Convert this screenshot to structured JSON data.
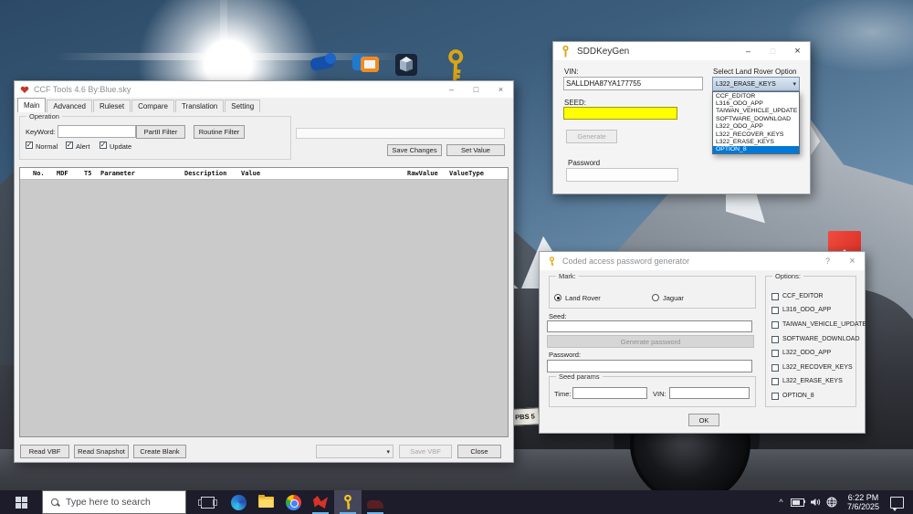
{
  "icons": {
    "minimize": "–",
    "maximize": "□",
    "close": "×",
    "help": "?",
    "dropdown_arrow": "▾",
    "check": "✓",
    "tray_chevron": "^"
  },
  "desktop": {
    "license_plate": "PBS 5",
    "taskbar": {
      "search_placeholder": "Type here to search",
      "clock_time": "6:22 PM",
      "clock_date": "7/6/2025"
    }
  },
  "ccf_tools": {
    "title": "CCF Tools 4.6  By:Blue.sky",
    "tabs": [
      "Main",
      "Advanced",
      "Ruleset",
      "Compare",
      "Translation",
      "Setting"
    ],
    "operation": {
      "label": "Operation",
      "keyword_label": "KeyWord:",
      "keyword_value": "",
      "partii_filter_button": "PartII Filter",
      "routine_filter_button": "Routine Filter",
      "filter_checkboxes": [
        "Normal",
        "Alert",
        "Update"
      ]
    },
    "save_changes_button": "Save Changes",
    "set_value_button": "Set Value",
    "table_headers": [
      "No.",
      "MDF",
      "T5",
      "Parameter",
      "Description",
      "Value",
      "RawValue",
      "ValueType"
    ],
    "bottom": {
      "read_vbf_button": "Read VBF",
      "read_snapshot_button": "Read Snapshot",
      "create_blank_button": "Create Blank",
      "save_vbf_button": "Save VBF",
      "close_button": "Close"
    }
  },
  "sddkeygen": {
    "title": "SDDKeyGen",
    "vin_label": "VIN:",
    "vin_value": "SALLDHA87YA177755",
    "option_label": "Select Land Rover Option",
    "selected_option": "L322_ERASE_KEYS",
    "dropdown_options": [
      "CCF_EDITOR",
      "L316_ODO_APP",
      "TAIWAN_VEHICLE_UPDATE",
      "SOFTWARE_DOWNLOAD",
      "L322_ODO_APP",
      "L322_RECOVER_KEYS",
      "L322_ERASE_KEYS",
      "OPTION_8"
    ],
    "highlighted_option": "OPTION_8",
    "seed_label": "SEED:",
    "seed_value": "",
    "generate_button": "Generate",
    "password_label": "Password",
    "password_value": ""
  },
  "password_generator": {
    "title": "Coded access password generator",
    "mark": {
      "label": "Mark:",
      "radio_land_rover": "Land Rover",
      "radio_jaguar": "Jaguar",
      "selected": "Land Rover"
    },
    "options_label": "Options:",
    "options": [
      "CCF_EDITOR",
      "L316_ODO_APP",
      "TAIWAN_VEHICLE_UPDATE",
      "SOFTWARE_DOWNLOAD",
      "L322_ODO_APP",
      "L322_RECOVER_KEYS",
      "L322_ERASE_KEYS",
      "OPTION_8"
    ],
    "seed_label": "Seed:",
    "seed_value": "",
    "generate_password_button": "Generate password",
    "password_label": "Password:",
    "password_value": "",
    "seed_params": {
      "label": "Seed params",
      "time_label": "Time:",
      "time_value": "",
      "vin_label": "VIN:",
      "vin_value": ""
    },
    "ok_button": "OK"
  },
  "colors": {
    "accent_blue": "#0078d7",
    "seed_field_yellow": "#ffff00",
    "selection_highlight": "#0078d7"
  }
}
